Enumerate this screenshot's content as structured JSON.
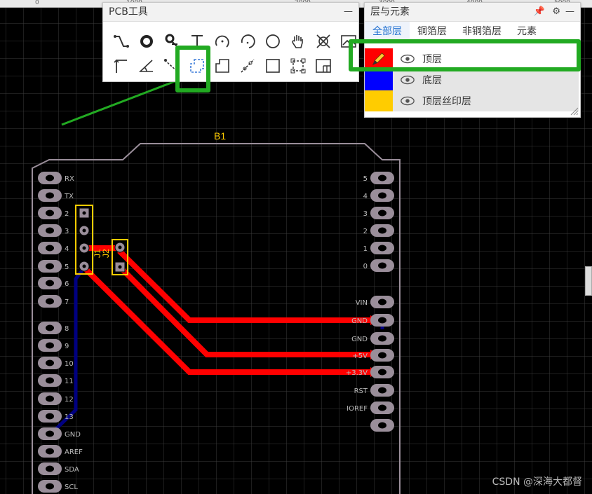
{
  "ruler": {
    "ticks": [
      "0",
      "1000",
      "2000",
      "3000",
      "4000",
      "5000"
    ]
  },
  "pcb_tools": {
    "title": "PCB工具",
    "minimize": "—",
    "row1_icons": [
      "track-icon",
      "via-icon",
      "pad-icon",
      "text-icon",
      "arc-center-icon",
      "arc-three-point-icon",
      "circle-icon",
      "pan-hand-icon",
      "no-connect-icon",
      "image-icon"
    ],
    "row2_icons": [
      "dimension-icon",
      "angle-icon",
      "connect-pad-icon",
      "copper-area-icon",
      "solid-region-icon",
      "rectangle-icon",
      "square-icon",
      "group-icon",
      "table-icon"
    ]
  },
  "layers_panel": {
    "title": "层与元素",
    "tabs": [
      "全部层",
      "铜箔层",
      "非铜箔层",
      "元素"
    ],
    "active_tab": "全部层",
    "layers": [
      {
        "name": "顶层",
        "color": "#ff0000",
        "active": true
      },
      {
        "name": "底层",
        "color": "#0000ff",
        "active": false
      },
      {
        "name": "顶层丝印层",
        "color": "#ffcc00",
        "active": false
      }
    ]
  },
  "board": {
    "name": "B1",
    "left_labels": [
      "RX",
      "TX",
      "2",
      "3",
      "4",
      "5",
      "6",
      "7",
      "8",
      "9",
      "10",
      "11",
      "12",
      "13",
      "GND",
      "AREF",
      "SDA",
      "SCL"
    ],
    "right_labels": [
      "5",
      "4",
      "3",
      "2",
      "1",
      "0",
      "VIN",
      "GND",
      "GND",
      "+5V",
      "+3.3V",
      "RST",
      "IOREF",
      ""
    ],
    "connector_j1": "J1",
    "connector_j2": "J2"
  },
  "watermark": "CSDN @深海大都督",
  "colors": {
    "highlight": "#22aa22",
    "trace": "#ff0000",
    "bottom_trace": "#000080",
    "silk": "#ffcc00",
    "outline": "#9a8e9a",
    "grid": "#3a3a3a"
  }
}
